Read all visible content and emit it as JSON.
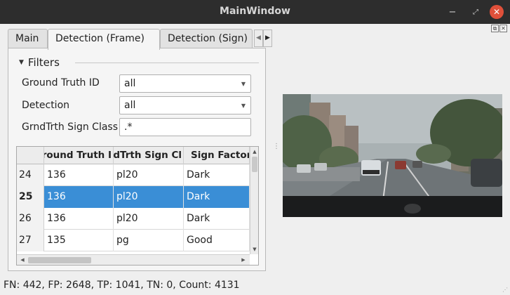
{
  "window": {
    "title": "MainWindow",
    "min_glyph": "−",
    "max_glyph": "⤢",
    "close_glyph": "✕"
  },
  "dock_buttons": {
    "float_glyph": "⧉",
    "close_glyph": "✕"
  },
  "tabs": {
    "items": [
      {
        "label": "Main"
      },
      {
        "label": "Detection (Frame)"
      },
      {
        "label": "Detection (Sign)"
      }
    ],
    "active_index": 1,
    "scroll_left": "◀",
    "scroll_right": "▶"
  },
  "filters": {
    "group_label": "Filters",
    "collapse_glyph": "▼",
    "ground_truth_id": {
      "label": "Ground Truth ID",
      "value": "all"
    },
    "detection": {
      "label": "Detection",
      "value": "all"
    },
    "sign_class": {
      "label": "GrndTrth Sign Class",
      "value": ".*"
    },
    "combo_arrow": "▼"
  },
  "table": {
    "columns": [
      "Ground Truth ID",
      "GrndTrth Sign Class",
      "Sign Factor"
    ],
    "columns_visible": [
      "round Truth I",
      "dTrth Sign Cl",
      "Sign Factor"
    ],
    "rows": [
      {
        "row": "24",
        "ground_truth_id": "136",
        "sign_class": "pl20",
        "sign_factor": "Dark"
      },
      {
        "row": "25",
        "ground_truth_id": "136",
        "sign_class": "pl20",
        "sign_factor": "Dark"
      },
      {
        "row": "26",
        "ground_truth_id": "136",
        "sign_class": "pl20",
        "sign_factor": "Dark"
      },
      {
        "row": "27",
        "ground_truth_id": "135",
        "sign_class": "pg",
        "sign_factor": "Good"
      }
    ],
    "selected_row": "25",
    "scroll_up": "▲",
    "scroll_down": "▼",
    "scroll_left": "◀",
    "scroll_right": "▶"
  },
  "status_bar": {
    "text": "FN: 442, FP: 2648, TP: 1041, TN: 0, Count: 4131"
  },
  "colors": {
    "selection": "#3a8ed6",
    "titlebar": "#2d2d2d",
    "close_button": "#e0503a"
  }
}
